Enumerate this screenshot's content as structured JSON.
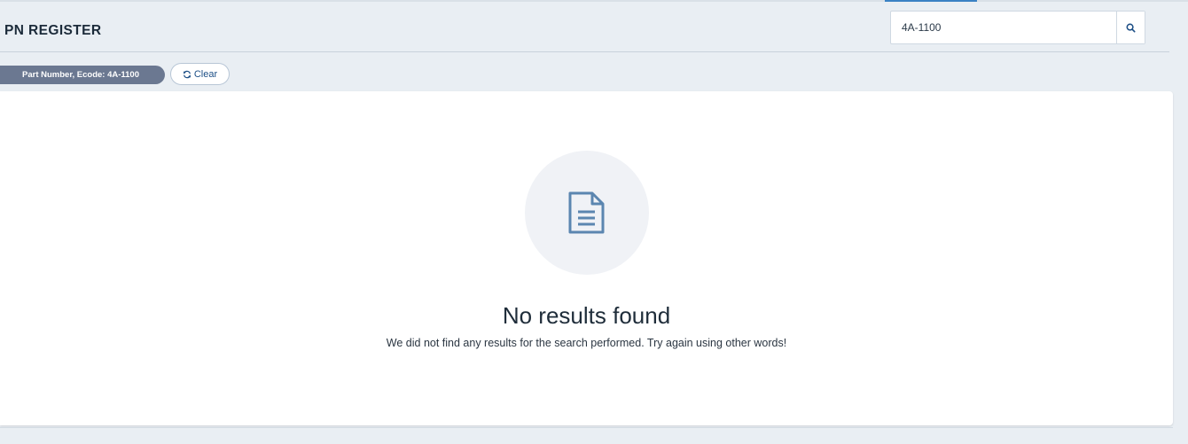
{
  "header": {
    "title": "PN REGISTER"
  },
  "search": {
    "value": "4A-1100",
    "button_icon": "search-icon"
  },
  "filters": {
    "active_chip": "Part Number, Ecode: 4A-1100",
    "clear_label": "Clear",
    "clear_icon": "refresh-icon"
  },
  "results": {
    "empty_icon": "document-icon",
    "empty_title": "No results found",
    "empty_message": "We did not find any results for the search performed. Try again using other words!"
  },
  "colors": {
    "page_background": "#e9eef3",
    "chip_background": "#6b7891",
    "accent": "#1d4f86",
    "icon_blue": "#5b86b0"
  }
}
